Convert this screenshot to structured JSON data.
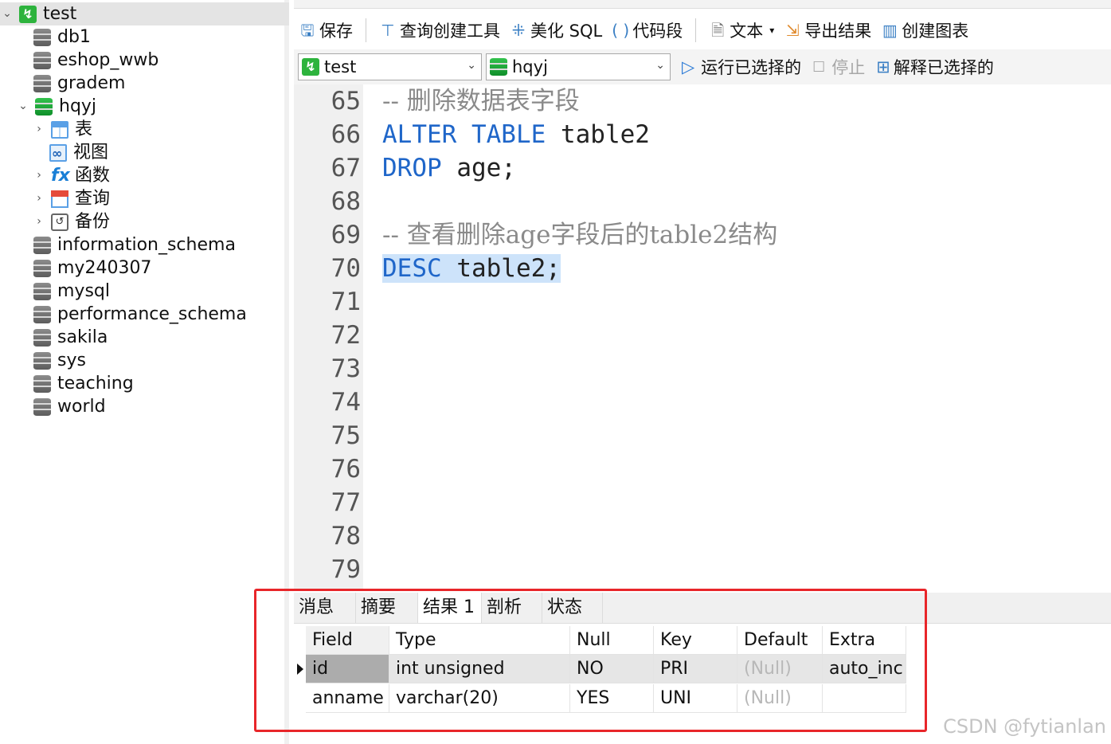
{
  "sidebar": {
    "items": [
      {
        "label": "test",
        "icon": "connection-icon",
        "chevron": "⌄"
      },
      {
        "label": "db1",
        "icon": "database-icon"
      },
      {
        "label": "eshop_wwb",
        "icon": "database-icon"
      },
      {
        "label": "gradem",
        "icon": "database-icon"
      },
      {
        "label": "hqyj",
        "icon": "database-open-icon",
        "chevron": "⌄"
      },
      {
        "label": "表",
        "icon": "table-icon",
        "chevron": "›"
      },
      {
        "label": "视图",
        "icon": "view-icon"
      },
      {
        "label": "函数",
        "icon": "function-icon",
        "chevron": "›"
      },
      {
        "label": "查询",
        "icon": "query-icon",
        "chevron": "›"
      },
      {
        "label": "备份",
        "icon": "backup-icon",
        "chevron": "›"
      },
      {
        "label": "information_schema",
        "icon": "database-icon"
      },
      {
        "label": "my240307",
        "icon": "database-icon"
      },
      {
        "label": "mysql",
        "icon": "database-icon"
      },
      {
        "label": "performance_schema",
        "icon": "database-icon"
      },
      {
        "label": "sakila",
        "icon": "database-icon"
      },
      {
        "label": "sys",
        "icon": "database-icon"
      },
      {
        "label": "teaching",
        "icon": "database-icon"
      },
      {
        "label": "world",
        "icon": "database-icon"
      }
    ]
  },
  "toolbar": {
    "save": "保存",
    "query_builder": "查询创建工具",
    "beautify": "美化 SQL",
    "snippet": "代码段",
    "text": "文本",
    "export": "导出结果",
    "chart": "创建图表"
  },
  "dbbar": {
    "connection": "test",
    "database": "hqyj",
    "run_selected": "运行已选择的",
    "stop": "停止",
    "explain_selected": "解释已选择的"
  },
  "editor": {
    "lines": [
      {
        "n": "65",
        "parts": [
          {
            "t": "-- 删除数据表字段",
            "c": "cm"
          }
        ]
      },
      {
        "n": "66",
        "parts": [
          {
            "t": "ALTER TABLE",
            "c": "kw"
          },
          {
            "t": " table2",
            "c": ""
          }
        ]
      },
      {
        "n": "67",
        "parts": [
          {
            "t": "DROP",
            "c": "kw"
          },
          {
            "t": " age;",
            "c": ""
          }
        ]
      },
      {
        "n": "68",
        "parts": []
      },
      {
        "n": "69",
        "parts": [
          {
            "t": "-- 查看删除age字段后的table2结构",
            "c": "cm"
          }
        ]
      },
      {
        "n": "70",
        "parts": [
          {
            "t": "DESC",
            "c": "kw hl"
          },
          {
            "t": " table2;",
            "c": "hl"
          }
        ]
      },
      {
        "n": "71",
        "parts": []
      },
      {
        "n": "72",
        "parts": []
      },
      {
        "n": "73",
        "parts": []
      },
      {
        "n": "74",
        "parts": []
      },
      {
        "n": "75",
        "parts": []
      },
      {
        "n": "76",
        "parts": []
      },
      {
        "n": "77",
        "parts": []
      },
      {
        "n": "78",
        "parts": []
      },
      {
        "n": "79",
        "parts": []
      }
    ]
  },
  "result": {
    "tabs": [
      "消息",
      "摘要",
      "结果 1",
      "剖析",
      "状态"
    ],
    "active_tab": 2,
    "columns": [
      "Field",
      "Type",
      "Null",
      "Key",
      "Default",
      "Extra"
    ],
    "rows": [
      [
        "id",
        "int unsigned",
        "NO",
        "PRI",
        "(Null)",
        "auto_inc"
      ],
      [
        "anname",
        "varchar(20)",
        "YES",
        "UNI",
        "(Null)",
        ""
      ]
    ],
    "selected_row": 0
  },
  "watermark": "CSDN @fytianlan",
  "colors": {
    "keyword": "#1f66c9",
    "comment": "#8a8a8a",
    "highlight": "#cde3fa",
    "annotation_box": "#e8262a"
  }
}
